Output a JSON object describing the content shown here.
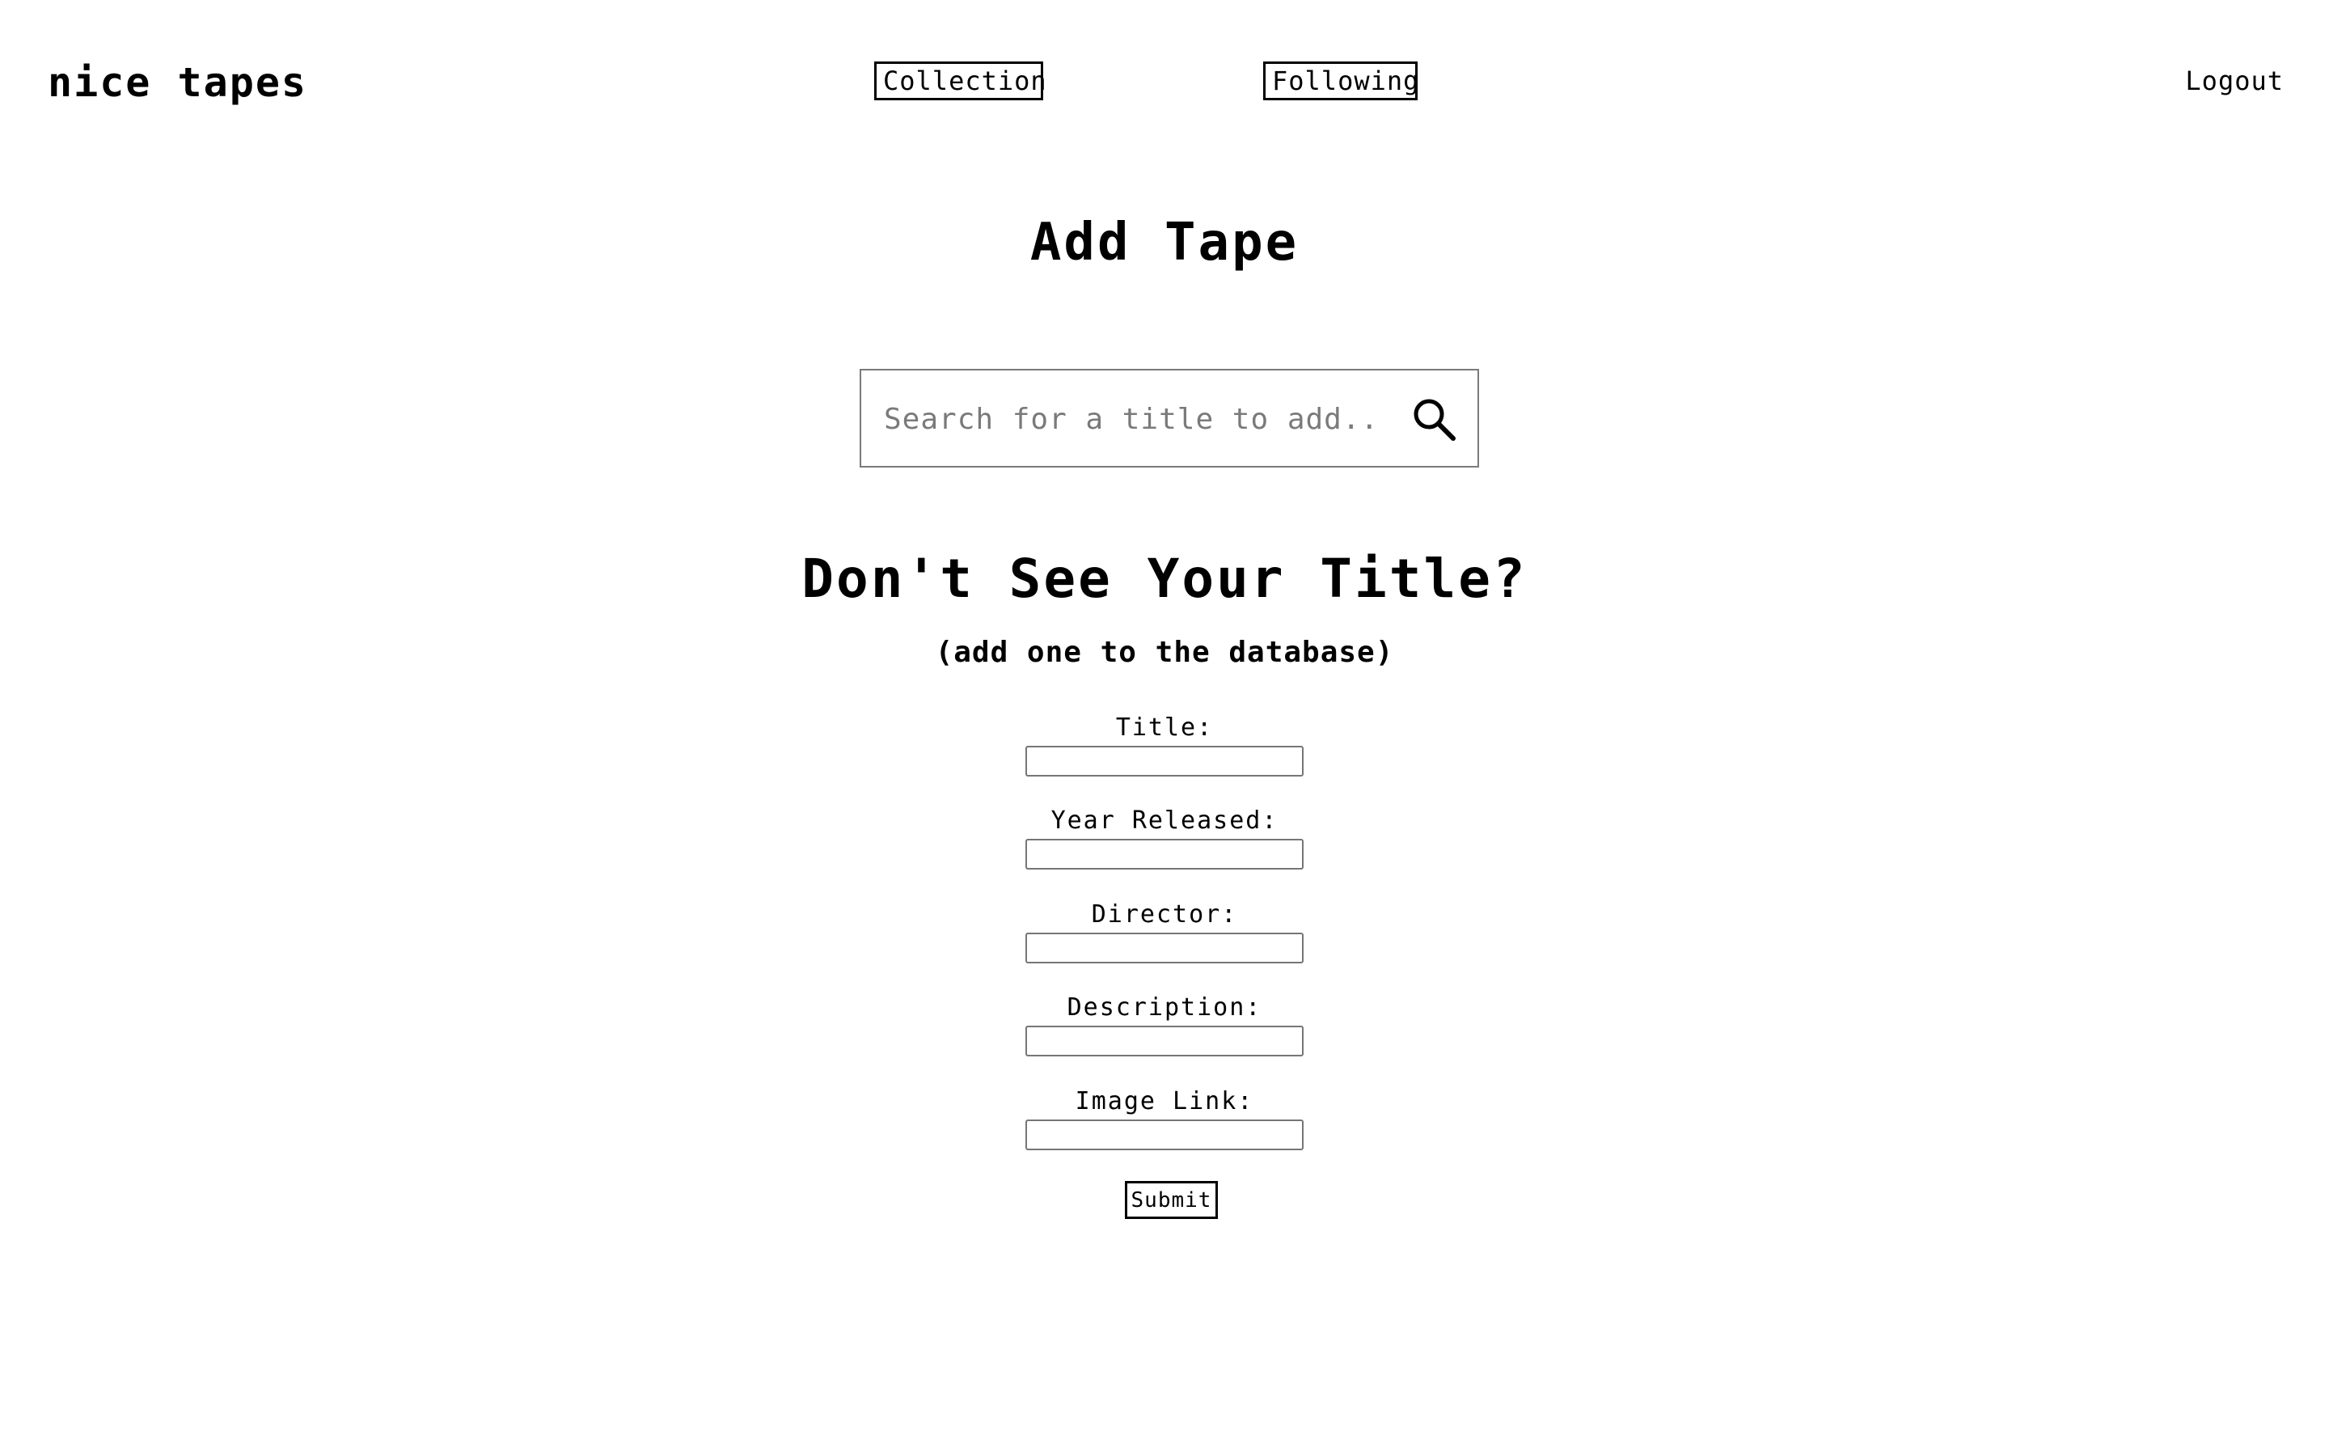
{
  "header": {
    "brand": "nice tapes",
    "nav": {
      "collection_label": "Collection",
      "following_label": "Following"
    },
    "logout_label": "Logout"
  },
  "main": {
    "title": "Add Tape",
    "search": {
      "placeholder": "Search for a title to add...",
      "value": "",
      "icon": "search-icon"
    },
    "add_section": {
      "title": "Don't See Your Title?",
      "subtitle": "(add one to the database)",
      "fields": [
        {
          "label": "Title:",
          "value": ""
        },
        {
          "label": "Year Released:",
          "value": ""
        },
        {
          "label": "Director:",
          "value": ""
        },
        {
          "label": "Description:",
          "value": ""
        },
        {
          "label": "Image Link:",
          "value": ""
        }
      ],
      "submit_label": "Submit"
    }
  }
}
